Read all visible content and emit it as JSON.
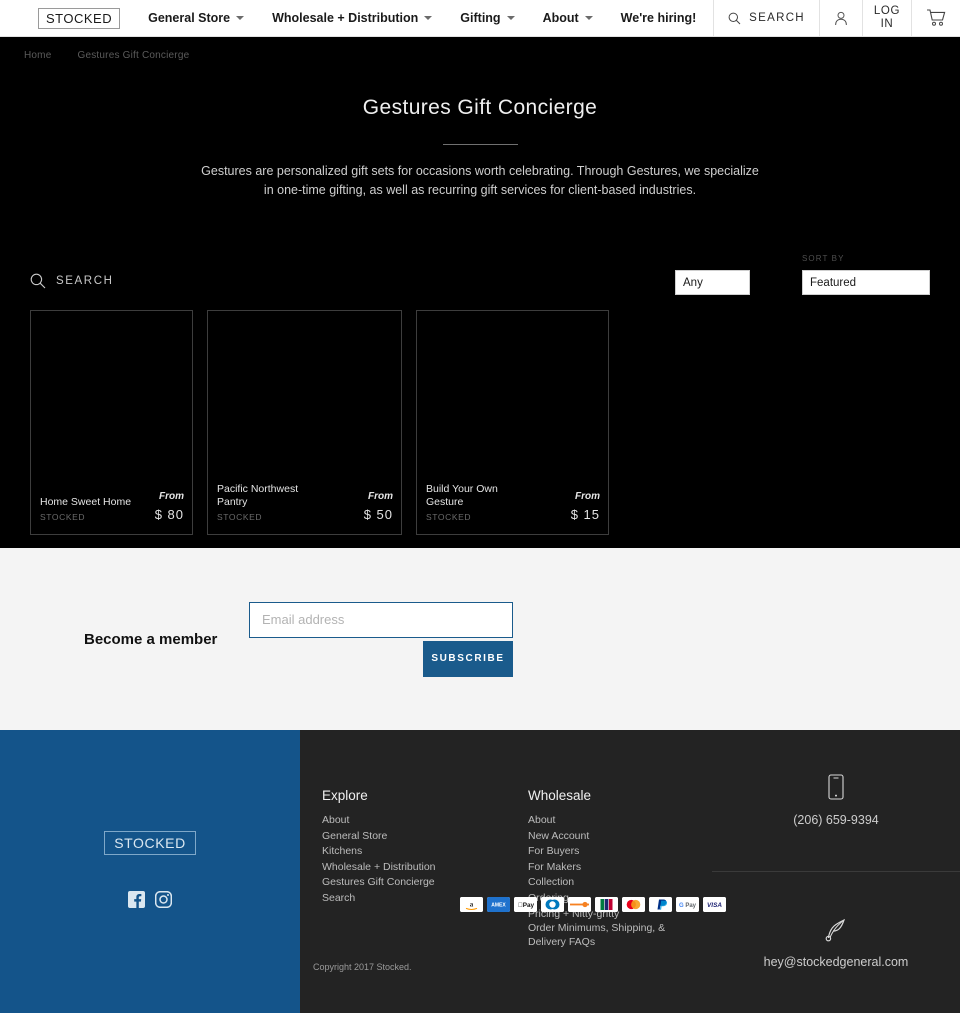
{
  "header": {
    "logo": "STOCKED",
    "nav": [
      {
        "label": "General Store",
        "has_caret": true
      },
      {
        "label": "Wholesale + Distribution",
        "has_caret": true
      },
      {
        "label": "Gifting",
        "has_caret": true
      },
      {
        "label": "About",
        "has_caret": true
      },
      {
        "label": "We're hiring!",
        "has_caret": false
      }
    ],
    "search_label": "SEARCH",
    "login_line1": "LOG",
    "login_line2": "IN"
  },
  "breadcrumb": {
    "home": "Home",
    "current": "Gestures Gift Concierge"
  },
  "hero": {
    "title": "Gestures Gift Concierge",
    "description": "Gestures are personalized gift sets for occasions worth celebrating. Through Gestures, we specialize in one-time gifting, as well as recurring gift services for client-based industries."
  },
  "collection_toolbar": {
    "search_label": "SEARCH",
    "filter_label": "",
    "filter_value": "Any",
    "sort_label": "SORT BY",
    "sort_value": "Featured",
    "filter_options": [
      "Any"
    ],
    "sort_options": [
      "Featured"
    ]
  },
  "products": [
    {
      "title": "Home Sweet Home",
      "vendor": "STOCKED",
      "from": "From",
      "price": "$ 80"
    },
    {
      "title": "Pacific Northwest Pantry",
      "vendor": "STOCKED",
      "from": "From",
      "price": "$ 50"
    },
    {
      "title": "Build Your Own Gesture",
      "vendor": "STOCKED",
      "from": "From",
      "price": "$ 15"
    }
  ],
  "newsletter": {
    "title": "Become a member",
    "placeholder": "Email address",
    "value": "",
    "button": "SUBSCRIBE"
  },
  "footer": {
    "logo": "STOCKED",
    "social": [
      "facebook-icon",
      "instagram-icon"
    ],
    "columns": [
      {
        "title": "Explore",
        "links": [
          "About",
          "General Store",
          "Kitchens",
          "Wholesale + Distribution",
          "Gestures Gift Concierge",
          "Search"
        ]
      },
      {
        "title": "Wholesale",
        "links": [
          "About",
          "New Account",
          "For Buyers",
          "For Makers",
          "Collection",
          "Ordering",
          "Pricing + Nitty-gritty",
          "Order Minimums, Shipping, & Delivery FAQs"
        ]
      }
    ],
    "payments": [
      "amazon",
      "amex",
      "apple-pay",
      "diners",
      "discover",
      "jcb",
      "mastercard",
      "paypal",
      "google-pay",
      "visa"
    ],
    "copyright": "Copyright 2017 Stocked.",
    "phone": "(206) 659-9394",
    "email": "hey@stockedgeneral.com"
  },
  "colors": {
    "brand_blue": "#14548a",
    "accent_blue": "#1a5b8c",
    "dark": "#000000",
    "footer_dark": "#232323"
  }
}
